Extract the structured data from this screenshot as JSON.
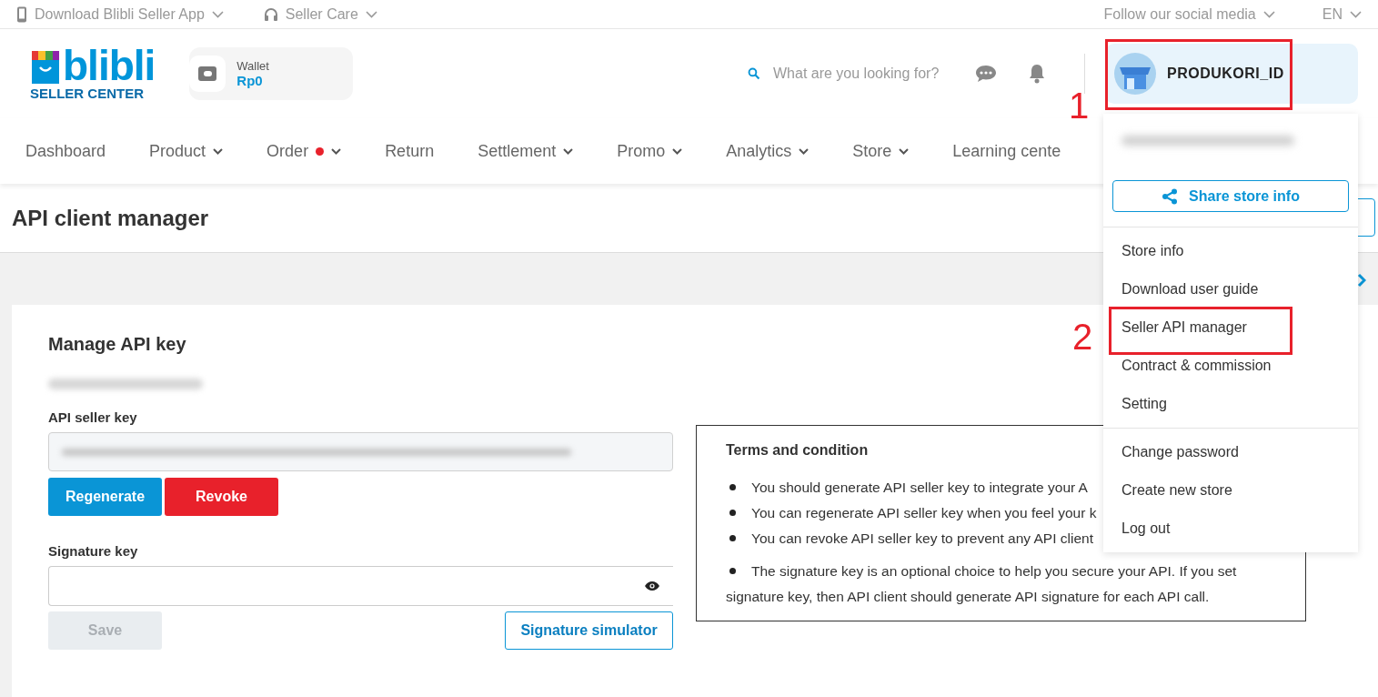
{
  "top_bar": {
    "left": [
      {
        "label": "Download Blibli Seller App"
      },
      {
        "label": "Seller Care"
      }
    ],
    "right": [
      "Follow our social media",
      "EN"
    ]
  },
  "header": {
    "logo": {
      "name": "blibli",
      "subtitle": "SELLER CENTER"
    },
    "wallet": {
      "label": "Wallet",
      "amount": "Rp0"
    },
    "search": {
      "placeholder": "What are you looking for?"
    },
    "profile": {
      "name": "PRODUKORI_ID"
    }
  },
  "nav": [
    {
      "label": "Dashboard",
      "dropdown": false,
      "badge": false
    },
    {
      "label": "Product",
      "dropdown": true,
      "badge": false
    },
    {
      "label": "Order",
      "dropdown": true,
      "badge": true
    },
    {
      "label": "Return",
      "dropdown": false,
      "badge": false
    },
    {
      "label": "Settlement",
      "dropdown": true,
      "badge": false
    },
    {
      "label": "Promo",
      "dropdown": true,
      "badge": false
    },
    {
      "label": "Analytics",
      "dropdown": true,
      "badge": false
    },
    {
      "label": "Store",
      "dropdown": true,
      "badge": false
    },
    {
      "label": "Learning cente",
      "dropdown": false,
      "badge": false
    }
  ],
  "page_title": "API client manager",
  "manage": {
    "title": "Manage API key",
    "api_key_label": "API seller key",
    "buttons": [
      {
        "label": "Regenerate",
        "kind": "primary"
      },
      {
        "label": "Revoke",
        "kind": "danger"
      }
    ],
    "signature_label": "Signature key",
    "save": {
      "label": "Save",
      "disabled": true
    },
    "simulator": "Signature simulator"
  },
  "terms": {
    "title": "Terms and condition",
    "items": [
      "You should generate API seller key to integrate your A",
      "You can regenerate API seller key when you feel your k",
      "You can revoke API seller key to prevent any API client",
      "The signature key is an optional choice to help you secure your API. If you set signature key, then API client should generate API signature for each API call."
    ]
  },
  "menu": {
    "share_button": "Share store info",
    "groups": [
      [
        "Store info",
        "Download user guide",
        "Seller API manager",
        "Contract & commission",
        "Setting"
      ],
      [
        "Change password",
        "Create new store",
        "Log out"
      ]
    ]
  },
  "annotations": [
    "1",
    "2"
  ]
}
